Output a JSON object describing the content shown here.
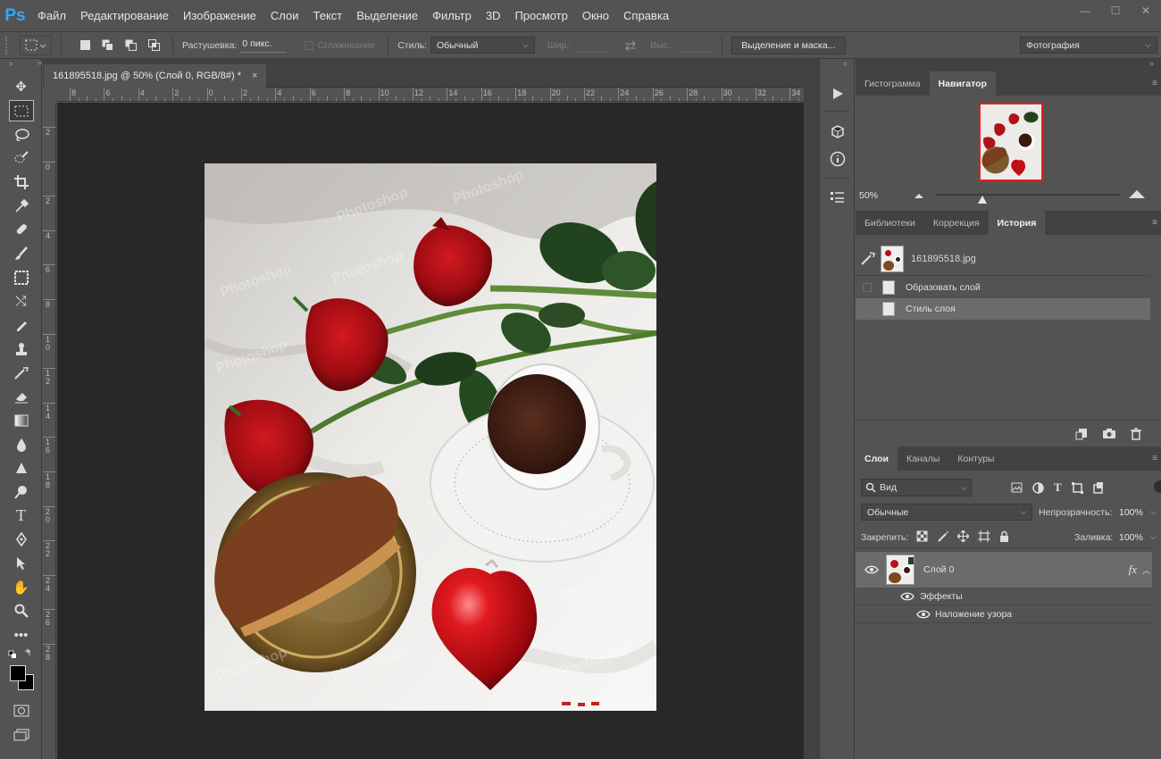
{
  "app": {
    "logo": "Ps"
  },
  "menu": [
    "Файл",
    "Редактирование",
    "Изображение",
    "Слои",
    "Текст",
    "Выделение",
    "Фильтр",
    "3D",
    "Просмотр",
    "Окно",
    "Справка"
  ],
  "window_controls": [
    "—",
    "☐",
    "✕"
  ],
  "options": {
    "feather_label": "Растушевка:",
    "feather_value": "0 пикс.",
    "antialias_label": "Сглаживание",
    "style_label": "Стиль:",
    "style_value": "Обычный",
    "width_label": "Шир.:",
    "height_label": "Выс.:",
    "select_mask_button": "Выделение и маска...",
    "workspace_value": "Фотография"
  },
  "document": {
    "tab_title": "161895518.jpg @ 50% (Слой 0, RGB/8#) *",
    "close": "×",
    "watermark": "Photoshop"
  },
  "ruler_top": [
    "8",
    "6",
    "4",
    "2",
    "0",
    "2",
    "4",
    "6",
    "8",
    "10",
    "12",
    "14",
    "16",
    "18",
    "20",
    "22",
    "24",
    "26",
    "28",
    "30",
    "32",
    "34"
  ],
  "ruler_left": [
    "2",
    "0",
    "2",
    "4",
    "6",
    "8",
    "1 0",
    "1 2",
    "1 4",
    "1 6",
    "1 8",
    "2 0",
    "2 2",
    "2 4",
    "2 6",
    "2 8"
  ],
  "navigator": {
    "tabs": [
      "Гистограмма",
      "Навигатор"
    ],
    "active_tab": "Навигатор",
    "zoom": "50%",
    "slider_level": 0.25
  },
  "history": {
    "tabs": [
      "Библиотеки",
      "Коррекция",
      "История"
    ],
    "active_tab": "История",
    "snapshot": "161895518.jpg",
    "steps": [
      "Образовать слой",
      "Стиль слоя"
    ],
    "selected_step": "Стиль слоя"
  },
  "layers": {
    "tabs": [
      "Слои",
      "Каналы",
      "Контуры"
    ],
    "active_tab": "Слои",
    "filter_kind": "Вид",
    "blend_mode": "Обычные",
    "opacity_label": "Непрозрачность:",
    "opacity_value": "100%",
    "lock_label": "Закрепить:",
    "fill_label": "Заливка:",
    "fill_value": "100%",
    "layer_name": "Слой 0",
    "fx": "fx",
    "effects_label": "Эффекты",
    "effect_name": "Наложение узора"
  }
}
